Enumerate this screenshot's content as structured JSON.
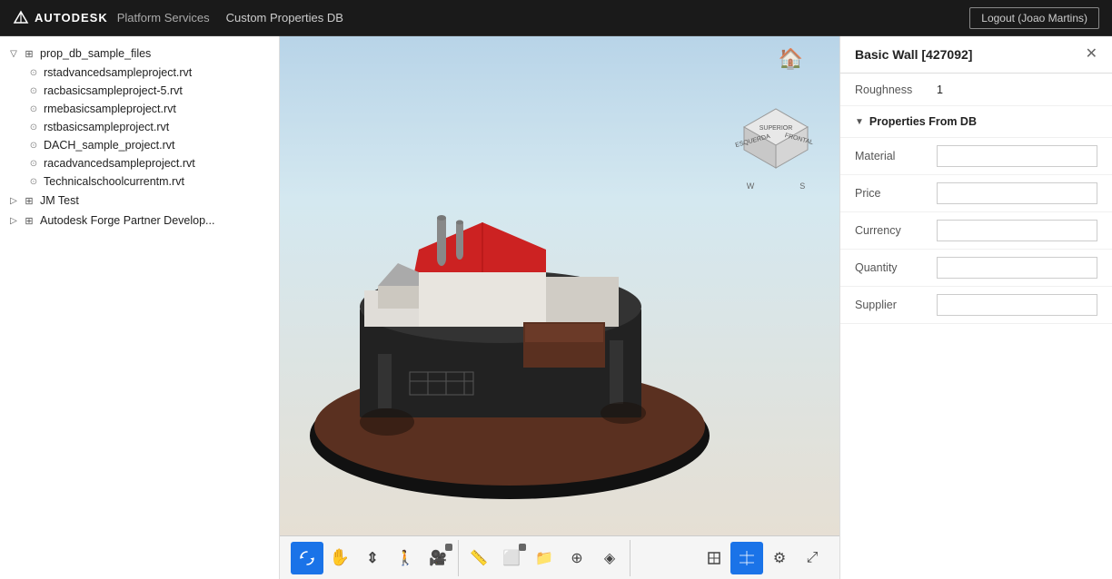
{
  "header": {
    "logo_text": "AUTODESK",
    "app_name": "Platform Services",
    "subtitle": "Custom Properties DB",
    "logout_label": "Logout (Joao Martins)"
  },
  "sidebar": {
    "groups": [
      {
        "id": "prop_db_sample_files",
        "label": "prop_db_sample_files",
        "expanded": true,
        "files": [
          "rstadvancedsampleproject.rvt",
          "racbasicsampleproject-5.rvt",
          "rmebasicsampleproject.rvt",
          "rstbasicsampleproject.rvt",
          "DACH_sample_project.rvt",
          "racadvancedsampleproject.rvt",
          "Technicalschoolcurrentm.rvt"
        ]
      },
      {
        "id": "jm_test",
        "label": "JM Test",
        "expanded": false,
        "files": []
      },
      {
        "id": "autodesk_forge",
        "label": "Autodesk Forge Partner Develop...",
        "expanded": false,
        "files": []
      }
    ]
  },
  "properties_panel": {
    "title": "Basic Wall [427092]",
    "roughness_label": "Roughness",
    "roughness_value": "1",
    "section_label": "Properties From DB",
    "fields": [
      {
        "label": "Material",
        "value": ""
      },
      {
        "label": "Price",
        "value": ""
      },
      {
        "label": "Currency",
        "value": ""
      },
      {
        "label": "Quantity",
        "value": ""
      },
      {
        "label": "Supplier",
        "value": ""
      }
    ]
  },
  "toolbar": {
    "buttons": [
      {
        "id": "orbit",
        "icon": "↺",
        "active": true,
        "label": "Orbit"
      },
      {
        "id": "pan",
        "icon": "✋",
        "active": false,
        "label": "Pan"
      },
      {
        "id": "dolly",
        "icon": "⇕",
        "active": false,
        "label": "Dolly"
      },
      {
        "id": "walk",
        "icon": "🚶",
        "active": false,
        "label": "Walk"
      },
      {
        "id": "camera",
        "icon": "🎥",
        "active": false,
        "label": "Camera"
      },
      {
        "id": "measure",
        "icon": "📏",
        "active": false,
        "label": "Measure"
      },
      {
        "id": "section",
        "icon": "⬜",
        "active": false,
        "label": "Section"
      },
      {
        "id": "model-browser",
        "icon": "📁",
        "active": false,
        "label": "Model Browser"
      },
      {
        "id": "explode",
        "icon": "⊕",
        "active": false,
        "label": "Explode"
      },
      {
        "id": "layers",
        "icon": "◈",
        "active": false,
        "label": "Layers"
      },
      {
        "id": "structural",
        "icon": "⬡",
        "active": false,
        "label": "Structural"
      },
      {
        "id": "view-cube",
        "icon": "⊞",
        "active": true,
        "label": "ViewCube"
      },
      {
        "id": "settings",
        "icon": "⚙",
        "active": false,
        "label": "Settings"
      },
      {
        "id": "fullscreen",
        "icon": "⤢",
        "active": false,
        "label": "Fullscreen"
      }
    ]
  },
  "colors": {
    "accent": "#1a73e8",
    "roof_red": "#cc2222",
    "base_dark": "#1a1a1a",
    "ground_dark": "#111",
    "ground_brown": "#6b3a2a"
  }
}
